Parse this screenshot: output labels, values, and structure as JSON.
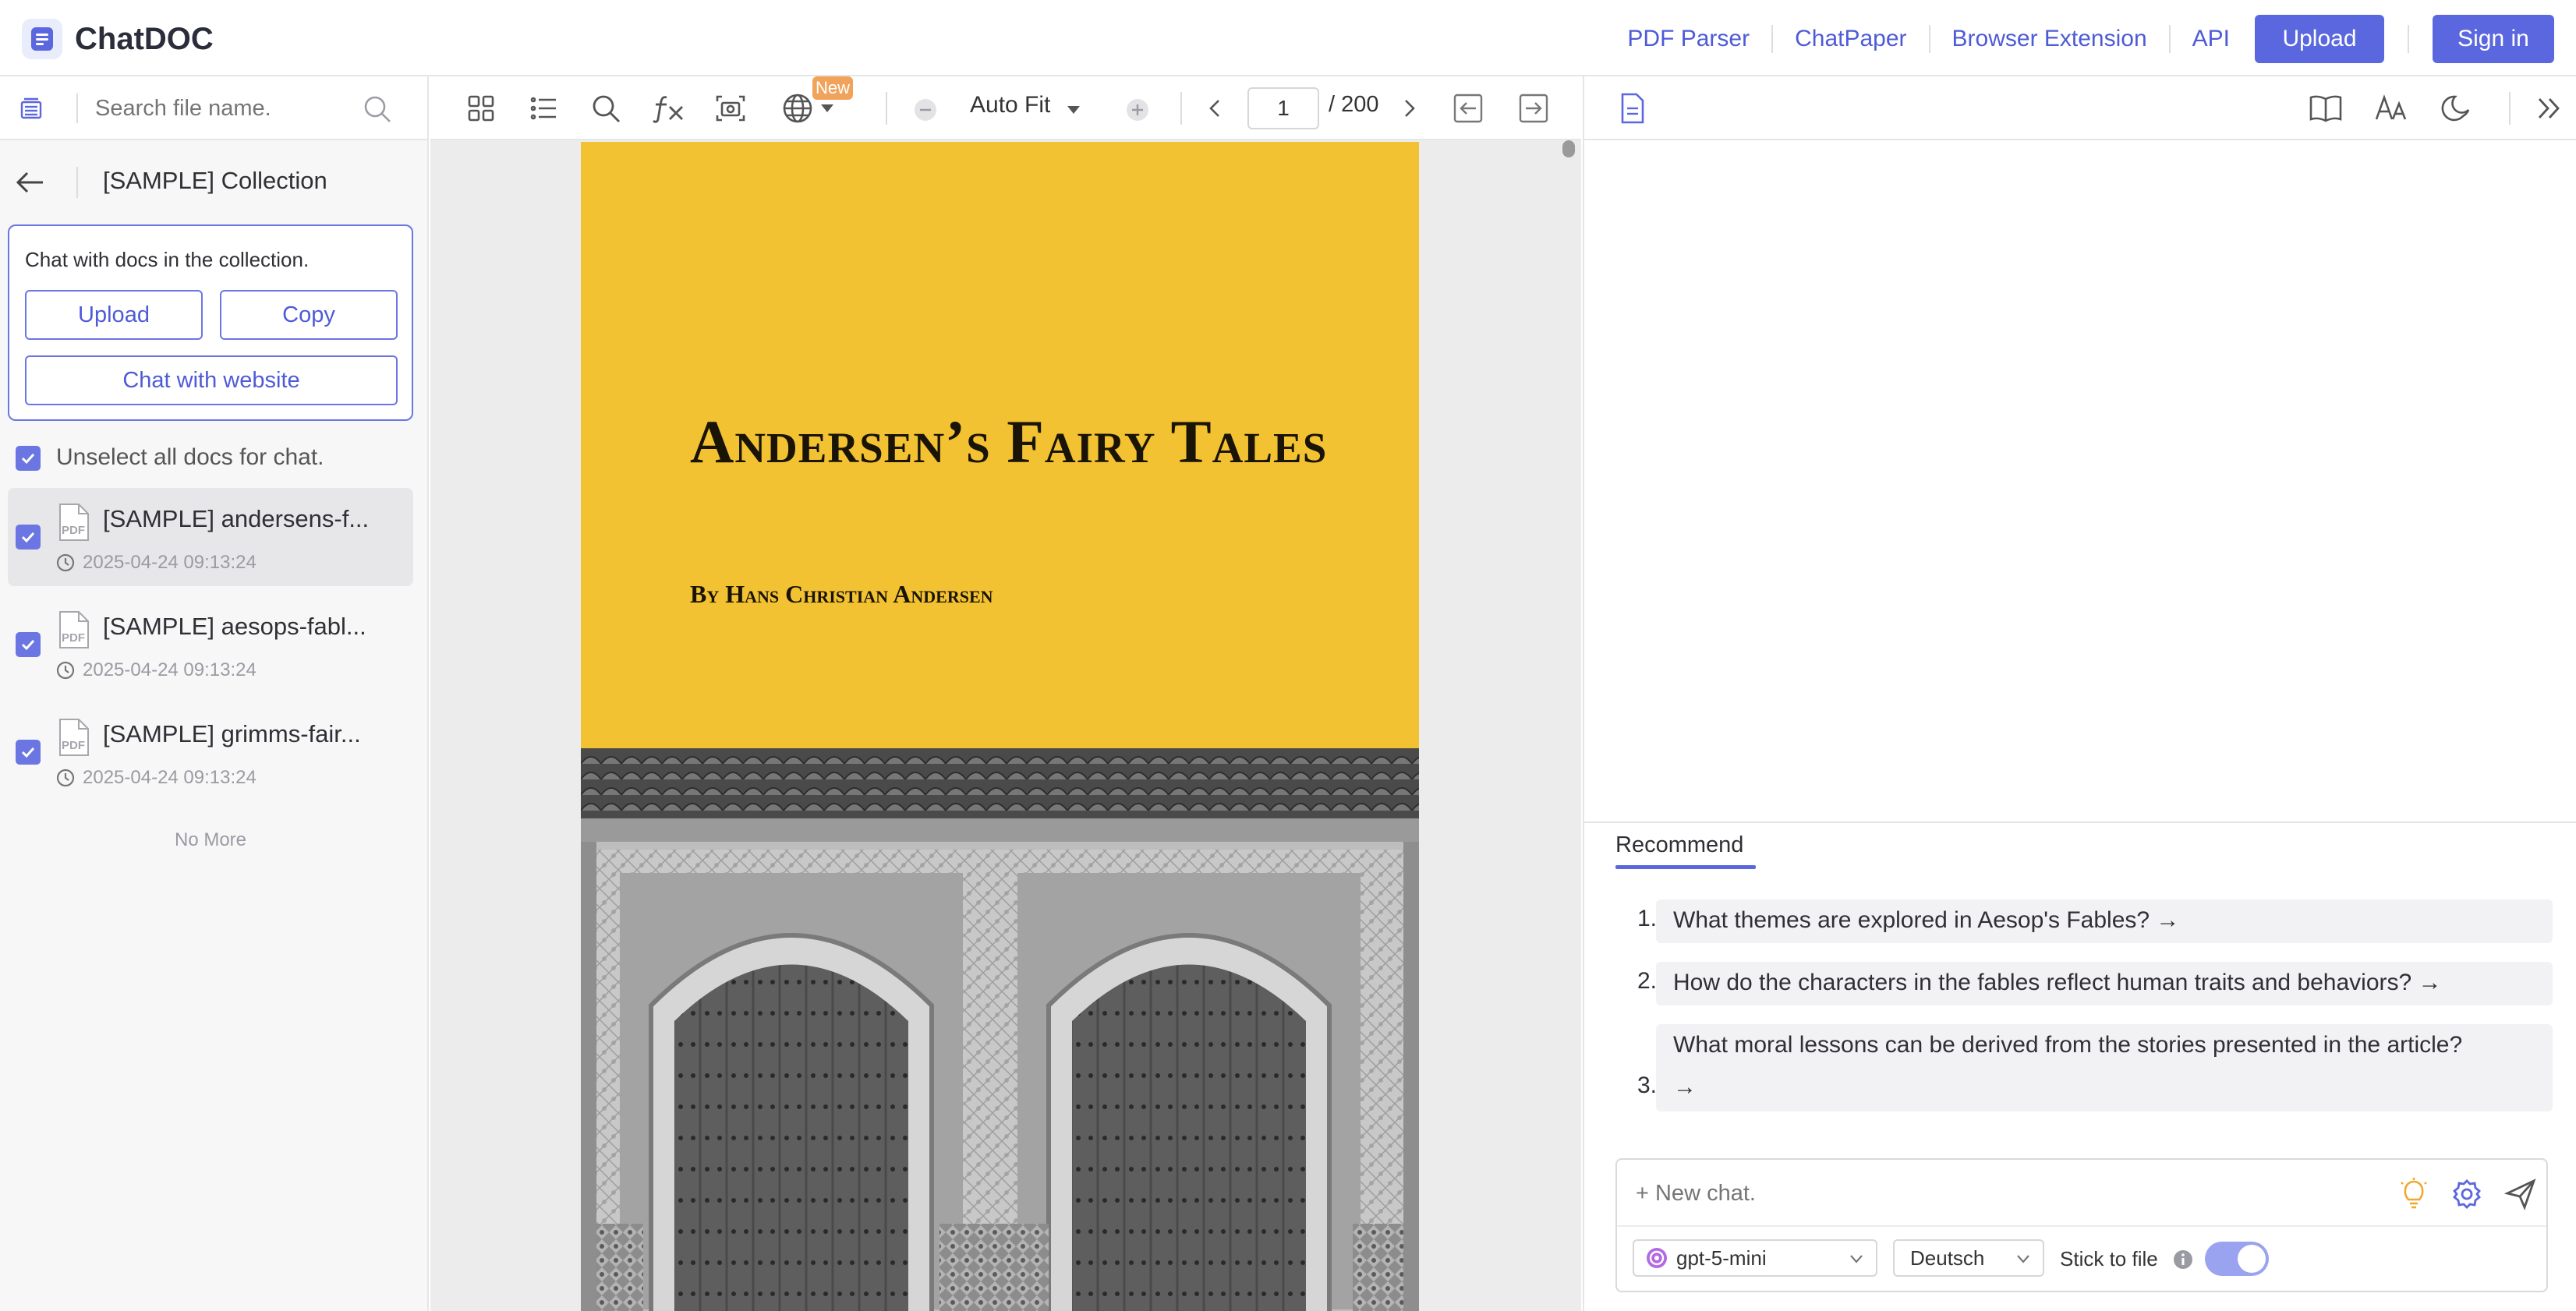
{
  "app": {
    "name": "ChatDOC",
    "brand_color": "#5b67de"
  },
  "nav": {
    "links": [
      "PDF Parser",
      "ChatPaper",
      "Browser Extension",
      "API"
    ],
    "upload_label": "Upload",
    "signin_label": "Sign in"
  },
  "sidebar": {
    "search_placeholder": "Search file name.",
    "collection_title": "[SAMPLE] Collection",
    "collection_hint": "Chat with docs in the collection.",
    "upload_label": "Upload",
    "copy_label": "Copy",
    "website_label": "Chat with website",
    "unselect_label": "Unselect all docs for chat.",
    "file_type": "PDF",
    "docs": [
      {
        "title": "[SAMPLE] andersens-f...",
        "date": "2025-04-24 09:13:24",
        "checked": true,
        "active": true
      },
      {
        "title": "[SAMPLE] aesops-fabl...",
        "date": "2025-04-24 09:13:24",
        "checked": true,
        "active": false
      },
      {
        "title": "[SAMPLE] grimms-fair...",
        "date": "2025-04-24 09:13:24",
        "checked": true,
        "active": false
      }
    ],
    "no_more": "No More"
  },
  "viewer": {
    "new_badge": "New",
    "zoom_label": "Auto Fit",
    "page_current": "1",
    "page_total": "/ 200",
    "cover_title": "Andersen’s Fairy Tales",
    "cover_author": "By Hans Christian Andersen",
    "cover_color": "#f3c233"
  },
  "chat": {
    "recommend_label": "Recommend",
    "recommendations": [
      {
        "num": "1.",
        "text": "What themes are explored in Aesop's Fables? →"
      },
      {
        "num": "2.",
        "text": "How do the characters in the fables reflect human traits and behaviors? →"
      },
      {
        "num": "3.",
        "text": "What moral lessons can be derived from the stories presented in the article?",
        "text2": "→"
      }
    ],
    "input_placeholder": "+ New chat.",
    "model": "gpt-5-mini",
    "language": "Deutsch",
    "stick_label": "Stick to file",
    "stick_enabled": true
  }
}
